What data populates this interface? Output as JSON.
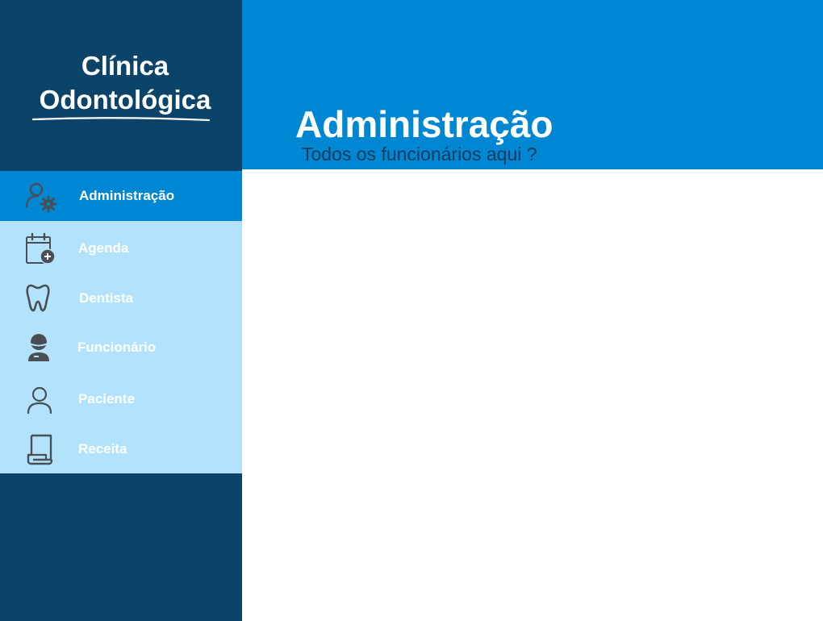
{
  "brand": {
    "line1": "Clínica",
    "line2": "Odontológica"
  },
  "header": {
    "title": "Administração",
    "subtitle": "Todos os funcionários aqui ?"
  },
  "nav": {
    "items": [
      {
        "label": "Administração",
        "icon": "admin-gear-icon",
        "active": true
      },
      {
        "label": "Agenda",
        "icon": "calendar-add-icon",
        "active": false
      },
      {
        "label": "Dentista",
        "icon": "tooth-icon",
        "active": false
      },
      {
        "label": "Funcionário",
        "icon": "employee-icon",
        "active": false
      },
      {
        "label": "Paciente",
        "icon": "person-icon",
        "active": false
      },
      {
        "label": "Receita",
        "icon": "prescription-icon",
        "active": false
      }
    ]
  },
  "colors": {
    "sidebar_bg": "#0b4468",
    "nav_bg": "#b3e3fc",
    "accent": "#0087d3",
    "icon": "#4a4f55",
    "subtitle": "#0d3b5c"
  }
}
